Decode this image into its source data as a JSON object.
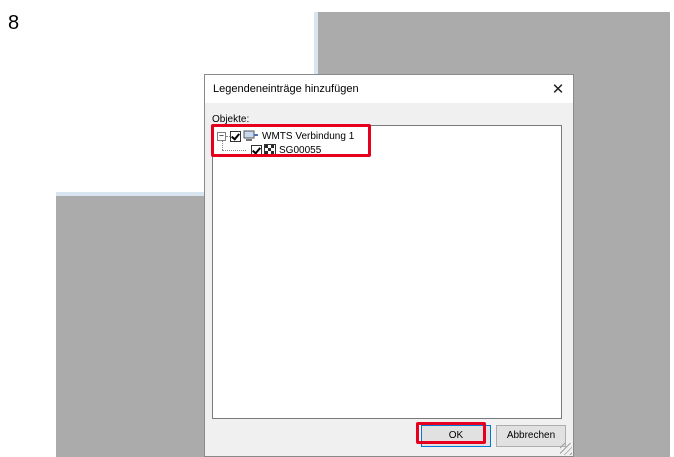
{
  "step": {
    "number": "8"
  },
  "dialog": {
    "title": "Legendeneinträge hinzufügen",
    "close_symbol": "✕",
    "objects_label": "Objekte:",
    "tree": [
      {
        "label": "WMTS Verbindung 1",
        "expander": "−",
        "checked": true,
        "icon": "wmts-connection-icon"
      },
      {
        "label": "SG00055",
        "checked": true,
        "icon": "raster-layer-icon"
      }
    ],
    "ok_label": "OK",
    "cancel_label": "Abbrechen"
  },
  "colors": {
    "highlight": "#e6001e",
    "background_app": "#ababab",
    "dialog_bg": "#f0f0f0"
  }
}
